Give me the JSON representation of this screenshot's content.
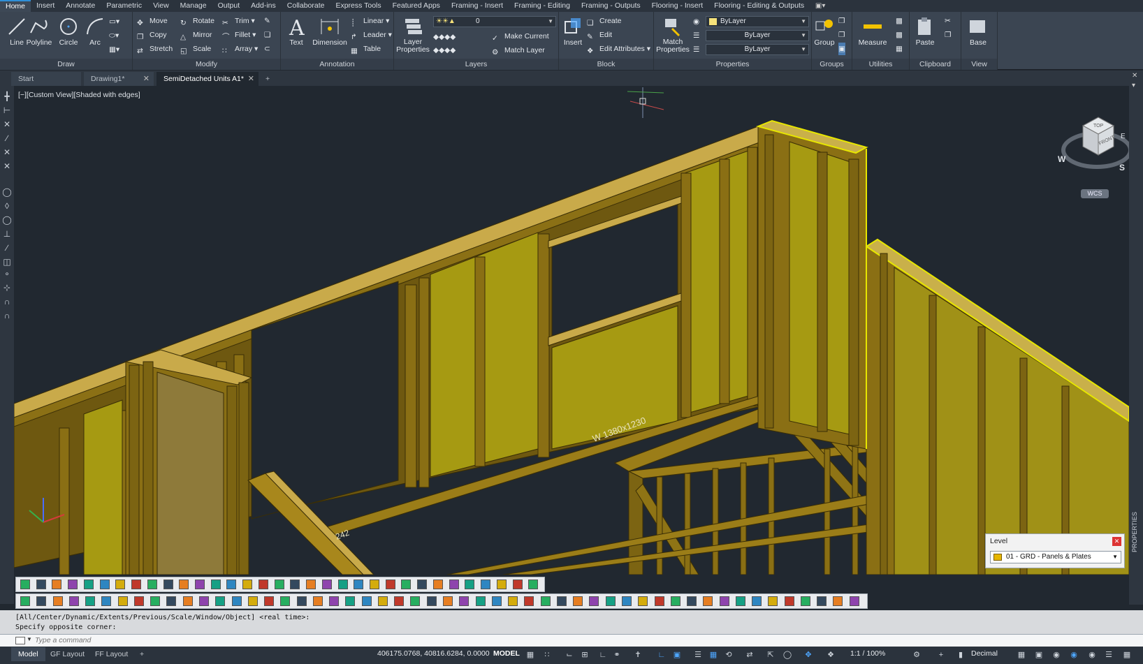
{
  "ribbon_tabs": [
    "Home",
    "Insert",
    "Annotate",
    "Parametric",
    "View",
    "Manage",
    "Output",
    "Add-ins",
    "Collaborate",
    "Express Tools",
    "Featured Apps",
    "Framing - Insert",
    "Framing - Editing",
    "Framing - Outputs",
    "Flooring - Insert",
    "Flooring - Editing & Outputs"
  ],
  "active_tab": "Home",
  "draw": {
    "title": "Draw",
    "line": "Line",
    "polyline": "Polyline",
    "circle": "Circle",
    "arc": "Arc"
  },
  "modify": {
    "title": "Modify",
    "move": "Move",
    "rotate": "Rotate",
    "trim": "Trim",
    "copy": "Copy",
    "mirror": "Mirror",
    "fillet": "Fillet",
    "stretch": "Stretch",
    "scale": "Scale",
    "array": "Array"
  },
  "annotation": {
    "title": "Annotation",
    "text": "Text",
    "dimension": "Dimension",
    "linear": "Linear",
    "leader": "Leader",
    "table": "Table"
  },
  "layers": {
    "title": "Layers",
    "layer_properties": "Layer Properties",
    "current_layer": "0",
    "make_current": "Make Current",
    "match_layer": "Match Layer"
  },
  "block": {
    "title": "Block",
    "insert": "Insert",
    "create": "Create",
    "edit": "Edit",
    "edit_attributes": "Edit Attributes"
  },
  "properties": {
    "title": "Properties",
    "match_properties": "Match Properties",
    "color": "ByLayer",
    "linetype": "ByLayer",
    "lineweight": "ByLayer"
  },
  "groups": {
    "title": "Groups",
    "group": "Group"
  },
  "utilities": {
    "title": "Utilities",
    "measure": "Measure"
  },
  "clipboard": {
    "title": "Clipboard",
    "paste": "Paste"
  },
  "view": {
    "title": "View",
    "base": "Base"
  },
  "doc_tabs": [
    {
      "label": "Start"
    },
    {
      "label": "Drawing1*"
    },
    {
      "label": "SemiDetached Units A1*"
    }
  ],
  "viewport": {
    "label": "[−][Custom View][Shaded with edges]",
    "window_tag": "W 1380x1230",
    "partial_tag": "242"
  },
  "viewcube": {
    "top": "TOP",
    "front": "FRONT",
    "w": "W",
    "s": "S",
    "e": "E",
    "wcs": "WCS"
  },
  "level_palette": {
    "title": "Level",
    "value": "01 - GRD - Panels & Plates"
  },
  "command": {
    "history": [
      "[All/Center/Dynamic/Extents/Previous/Scale/Window/Object] <real time>:",
      "Specify opposite corner:"
    ],
    "placeholder": "Type a command"
  },
  "layout_tabs": [
    "Model",
    "GF Layout",
    "FF Layout"
  ],
  "status": {
    "coords": "406175.0768, 40816.6284, 0.0000",
    "space": "MODEL",
    "scale": "1:1 / 100%",
    "units": "Decimal"
  },
  "side_palette_label": "PROPERTIES",
  "colors": {
    "timber": "#8a6f14",
    "panel": "#c7bd1e",
    "highlight": "#e7e600",
    "bg": "#212830"
  }
}
